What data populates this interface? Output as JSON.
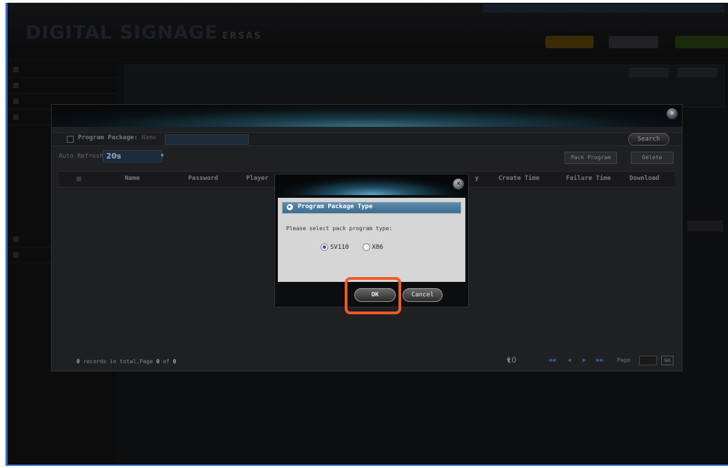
{
  "app": {
    "logo_text": "DIGITAL SIGNAGE",
    "logo_sub": "ERSAS"
  },
  "toolbar": {
    "package_label": "Program Package:",
    "name_label": "Name",
    "search_label": "Search",
    "auto_refresh_label": "Auto Refresh",
    "auto_refresh_value": "20s",
    "pack_program_label": "Pack Program",
    "delete_label": "Delete"
  },
  "table": {
    "columns": [
      "Name",
      "Password",
      "Player",
      "Create Time",
      "Failure Time",
      "Download"
    ],
    "column_partial": "y"
  },
  "footer": {
    "records_prefix": "0",
    "records_text": " records in total,Page ",
    "page_current": "0",
    "page_of": " of ",
    "page_total": "0",
    "page_size": "10",
    "page_label": "Page",
    "go_label": "Go"
  },
  "dialog": {
    "header": "Program Package Type",
    "prompt": "Please select pack program type:",
    "options": [
      {
        "label": "SV110",
        "selected": true
      },
      {
        "label": "X86",
        "selected": false
      }
    ],
    "ok_label": "OK",
    "cancel_label": "Cancel"
  },
  "colors": {
    "highlight": "#f15a24",
    "dialog_header": "#3e6c8f"
  }
}
